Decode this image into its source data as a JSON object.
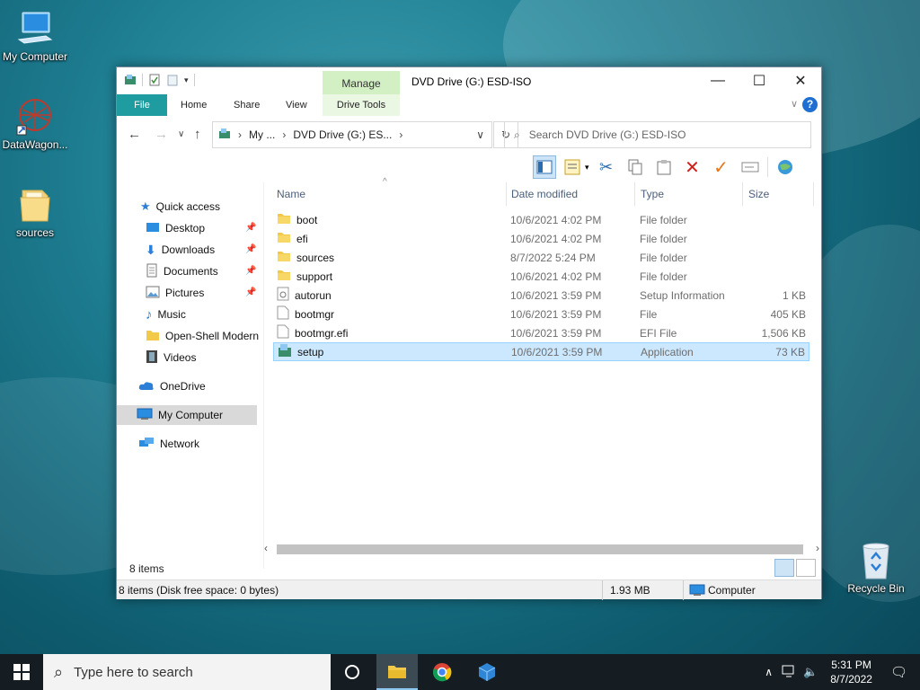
{
  "desktop": {
    "icons": [
      {
        "label": "My Computer"
      },
      {
        "label": "DataWagon..."
      },
      {
        "label": "sources"
      },
      {
        "label": "Recycle Bin"
      }
    ]
  },
  "window": {
    "title": "DVD Drive (G:) ESD-ISO",
    "context_tab_group": "Manage",
    "ribbon_tabs": [
      "File",
      "Home",
      "Share",
      "View",
      "Drive Tools"
    ],
    "address": {
      "segments": [
        "My ...",
        "DVD Drive (G:) ES..."
      ]
    },
    "search_placeholder": "Search DVD Drive (G:) ESD-ISO",
    "nav": {
      "quick_access": "Quick access",
      "items": [
        "Desktop",
        "Downloads",
        "Documents",
        "Pictures",
        "Music",
        "Open-Shell Modern",
        "Videos"
      ],
      "onedrive": "OneDrive",
      "my_computer": "My Computer",
      "network": "Network"
    },
    "columns": [
      "Name",
      "Date modified",
      "Type",
      "Size"
    ],
    "files": [
      {
        "name": "boot",
        "date": "10/6/2021 4:02 PM",
        "type": "File folder",
        "size": "",
        "icon": "folder"
      },
      {
        "name": "efi",
        "date": "10/6/2021 4:02 PM",
        "type": "File folder",
        "size": "",
        "icon": "folder"
      },
      {
        "name": "sources",
        "date": "8/7/2022 5:24 PM",
        "type": "File folder",
        "size": "",
        "icon": "folder"
      },
      {
        "name": "support",
        "date": "10/6/2021 4:02 PM",
        "type": "File folder",
        "size": "",
        "icon": "folder"
      },
      {
        "name": "autorun",
        "date": "10/6/2021 3:59 PM",
        "type": "Setup Information",
        "size": "1 KB",
        "icon": "inf"
      },
      {
        "name": "bootmgr",
        "date": "10/6/2021 3:59 PM",
        "type": "File",
        "size": "405 KB",
        "icon": "file"
      },
      {
        "name": "bootmgr.efi",
        "date": "10/6/2021 3:59 PM",
        "type": "EFI File",
        "size": "1,506 KB",
        "icon": "file"
      },
      {
        "name": "setup",
        "date": "10/6/2021 3:59 PM",
        "type": "Application",
        "size": "73 KB",
        "icon": "setup"
      }
    ],
    "item_count": "8 items",
    "status": {
      "left": "8 items (Disk free space: 0 bytes)",
      "size": "1.93 MB",
      "location": "Computer"
    }
  },
  "taskbar": {
    "search_placeholder": "Type here to search",
    "time": "5:31 PM",
    "date": "8/7/2022"
  },
  "colors": {
    "accent": "#1f9ca0",
    "manage": "#d3efc4",
    "selection": "#cce8ff",
    "taskbar": "#151d22"
  }
}
